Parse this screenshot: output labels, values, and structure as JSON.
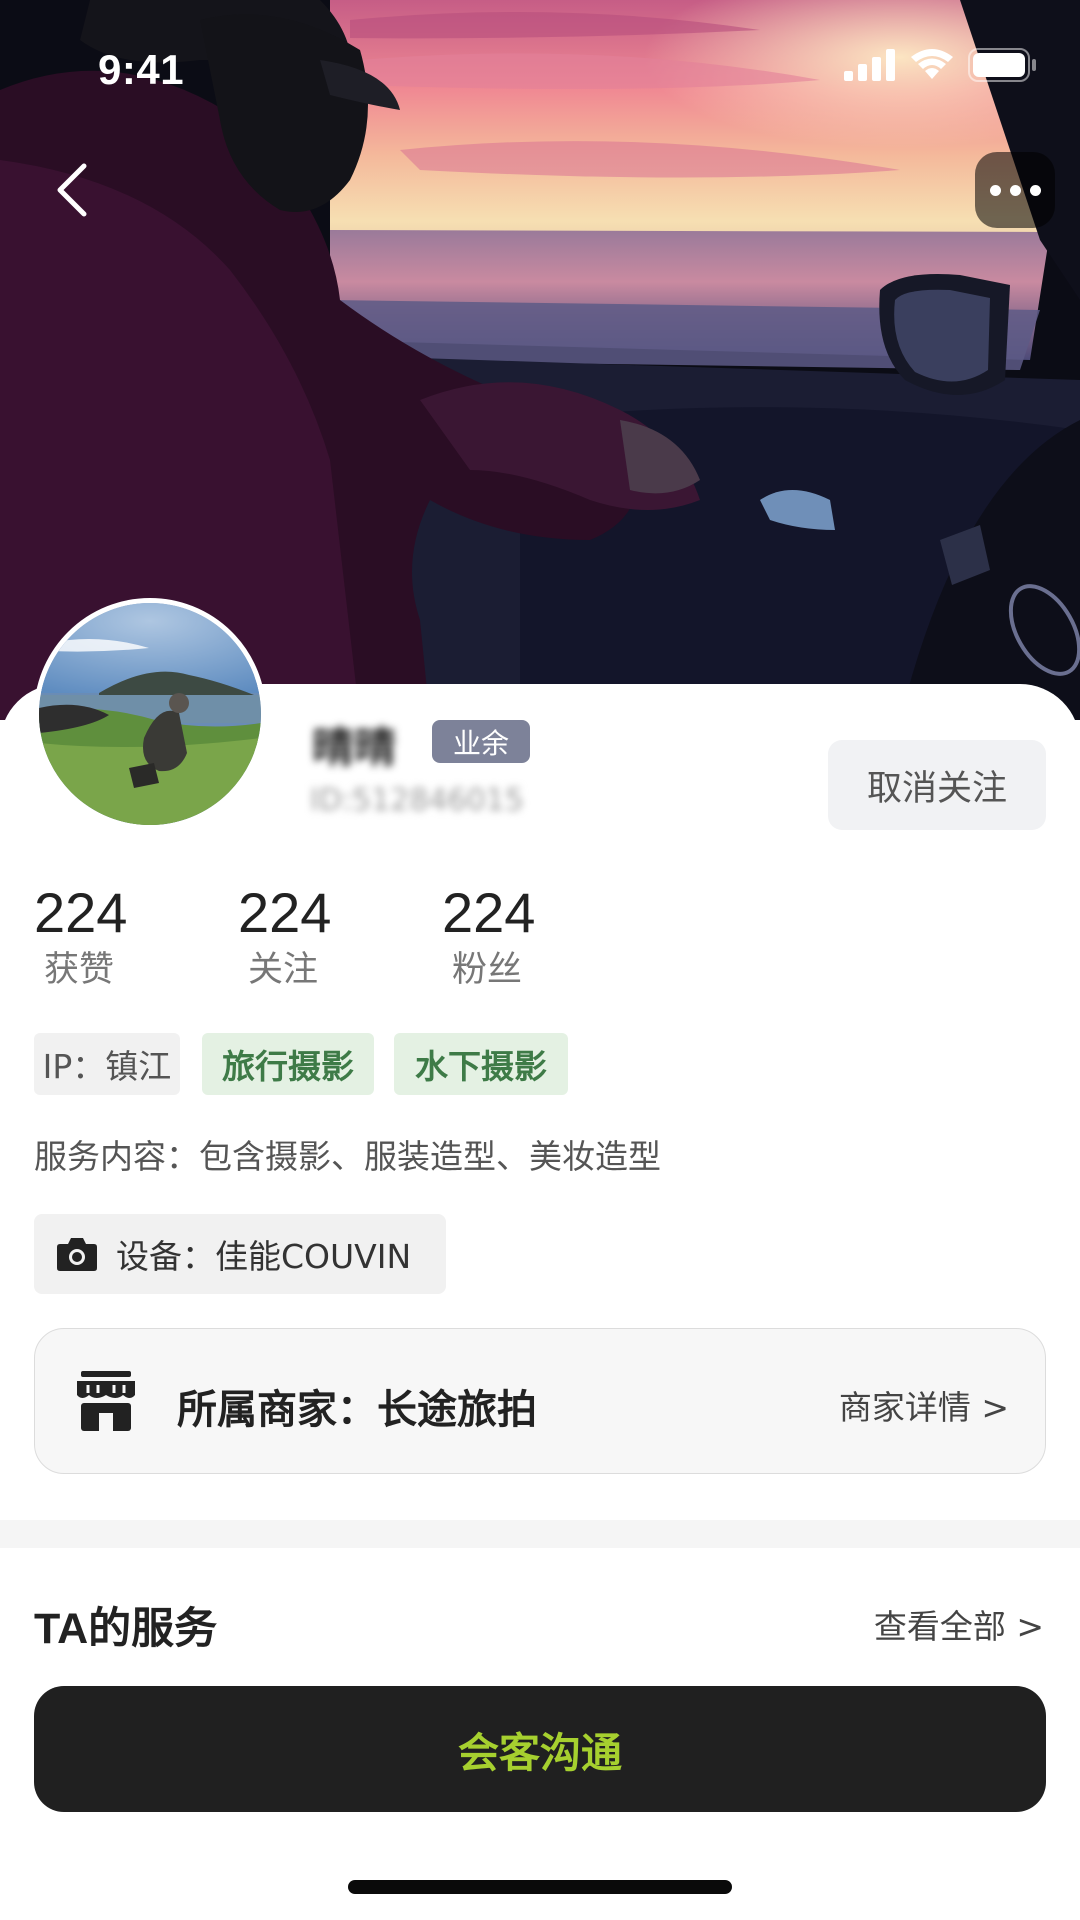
{
  "status_bar": {
    "time": "9:41"
  },
  "hero": {
    "image": "sunset-car-window-photo"
  },
  "profile": {
    "name": "晴晴",
    "badge": "业余",
    "id_text": "ID:512846015",
    "unfollow_label": "取消关注"
  },
  "stats": [
    {
      "value": "224",
      "label": "获赞"
    },
    {
      "value": "224",
      "label": "关注"
    },
    {
      "value": "224",
      "label": "粉丝"
    }
  ],
  "tags": {
    "ip": "IP：镇江",
    "items": [
      "旅行摄影",
      "水下摄影"
    ]
  },
  "service_content": "服务内容：包含摄影、服装造型、美妆造型",
  "equipment": "设备：佳能COUVIN",
  "merchant": {
    "label": "所属商家：长途旅拍",
    "link": "商家详情 >"
  },
  "services_section": {
    "title": "TA的服务",
    "view_all": "查看全部 >"
  },
  "cta_label": "会客沟通",
  "colors": {
    "badge_bg": "#7d8299",
    "tag_green_bg": "#e4f1e3",
    "tag_green_text": "#3e7b47",
    "cta_bg": "#202020",
    "cta_text": "#a6d02f"
  },
  "icons": {
    "back": "back-chevron-icon",
    "more": "more-dots-icon",
    "camera": "camera-icon",
    "store": "store-icon",
    "signal": "signal-icon",
    "wifi": "wifi-icon",
    "battery": "battery-icon"
  }
}
